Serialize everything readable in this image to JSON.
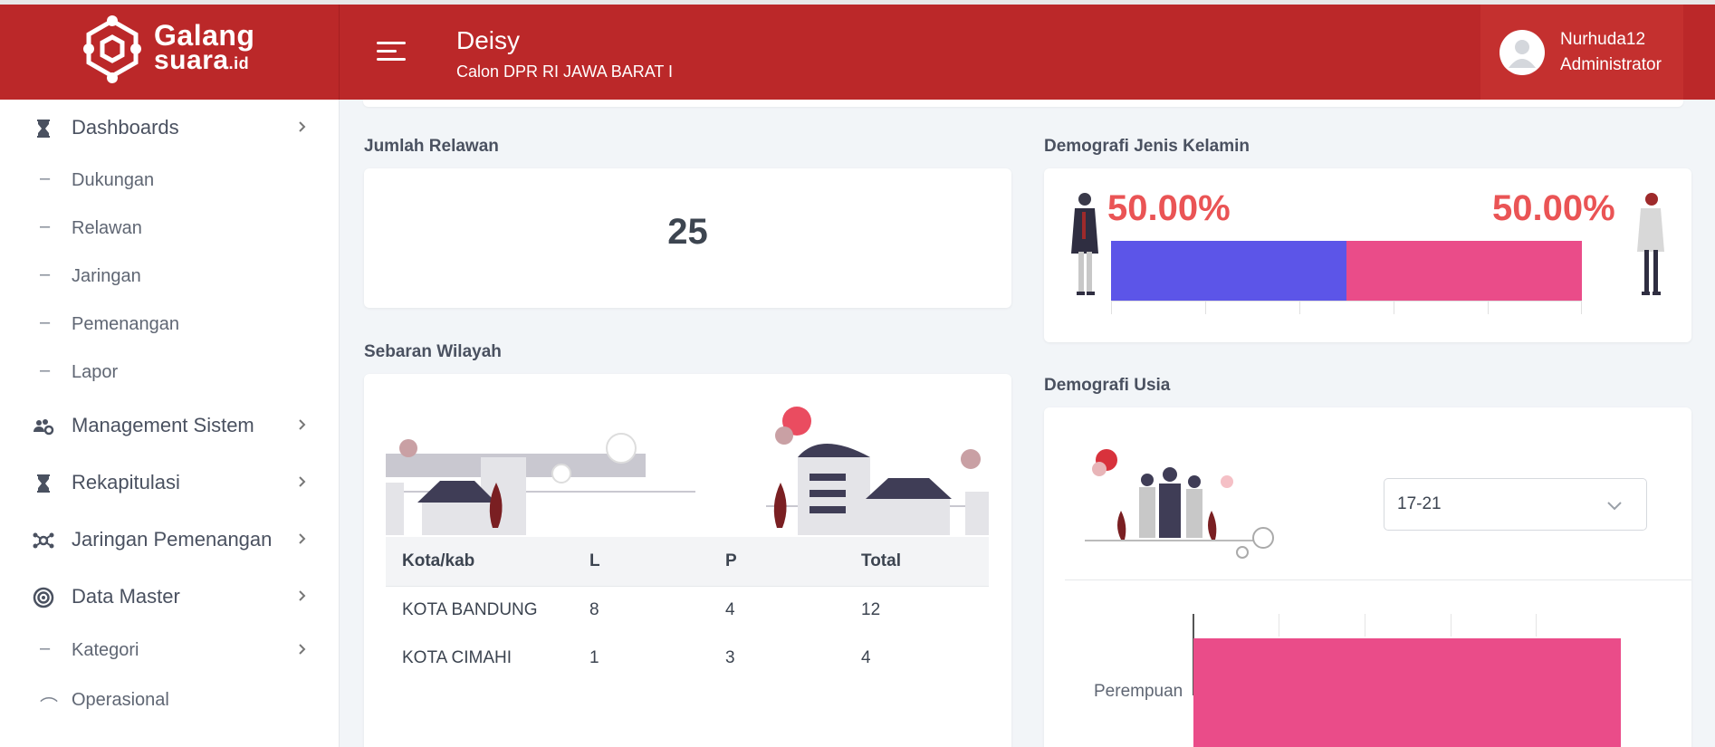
{
  "header": {
    "logo_line1": "Galang",
    "logo_line2": "suara",
    "logo_suffix": ".id",
    "candidate_name": "Deisy",
    "candidate_desc": "Calon DPR RI JAWA BARAT I",
    "user_name": "Nurhuda12",
    "user_role": "Administrator"
  },
  "sidebar": {
    "items": [
      {
        "label": "Dashboards",
        "icon": "hourglass-icon"
      },
      {
        "label": "Dukungan"
      },
      {
        "label": "Relawan"
      },
      {
        "label": "Jaringan"
      },
      {
        "label": "Pemenangan"
      },
      {
        "label": "Lapor"
      },
      {
        "label": "Management Sistem",
        "icon": "users-gear-icon"
      },
      {
        "label": "Rekapitulasi",
        "icon": "hourglass-icon"
      },
      {
        "label": "Jaringan Pemenangan",
        "icon": "network-icon"
      },
      {
        "label": "Data Master",
        "icon": "target-icon"
      },
      {
        "label": "Kategori"
      },
      {
        "label": "Operasional"
      }
    ]
  },
  "relawan": {
    "title": "Jumlah Relawan",
    "count": "25"
  },
  "gender": {
    "title": "Demografi Jenis Kelamin",
    "male_pct": "50.00%",
    "female_pct": "50.00%",
    "male_fraction": 0.5,
    "female_fraction": 0.5,
    "male_color": "#5c55e8",
    "female_color": "#ea4c89"
  },
  "wilayah": {
    "title": "Sebaran Wilayah",
    "columns": [
      "Kota/kab",
      "L",
      "P",
      "Total"
    ],
    "rows": [
      [
        "KOTA BANDUNG",
        "8",
        "4",
        "12"
      ],
      [
        "KOTA CIMAHI",
        "1",
        "3",
        "4"
      ]
    ]
  },
  "usia": {
    "title": "Demografi Usia",
    "selected_range": "17-21",
    "bar_label": "Perempuan"
  },
  "colors": {
    "brand": "#bb2829",
    "accent_red": "#ea5455"
  }
}
